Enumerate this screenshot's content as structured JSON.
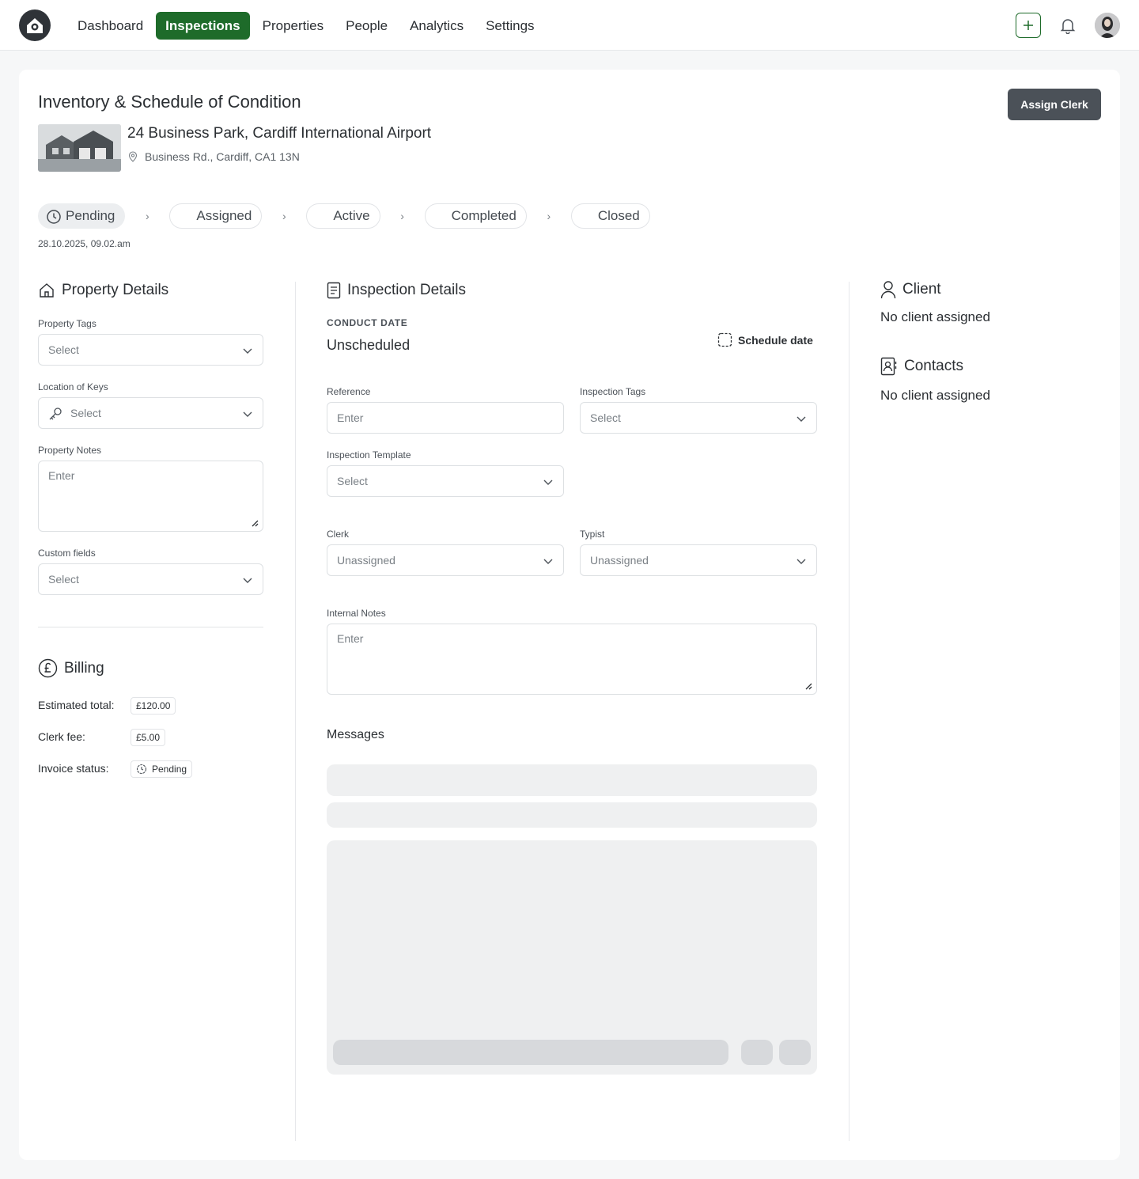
{
  "nav": {
    "items": [
      {
        "label": "Dashboard",
        "active": false
      },
      {
        "label": "Inspections",
        "active": true
      },
      {
        "label": "Properties",
        "active": false
      },
      {
        "label": "People",
        "active": false
      },
      {
        "label": "Analytics",
        "active": false
      },
      {
        "label": "Settings",
        "active": false
      }
    ],
    "accent": "#1e6b2a"
  },
  "header": {
    "title": "Inventory & Schedule of Condition",
    "assign_label": "Assign Clerk",
    "property_name": "24 Business Park, Cardiff International Airport",
    "property_address": "Business Rd., Cardiff, CA1 13N"
  },
  "pipeline": {
    "steps": [
      "Pending",
      "Assigned",
      "Active",
      "Completed",
      "Closed"
    ],
    "current": "Pending",
    "date": "28.10.2025, 09.02.am"
  },
  "property_details": {
    "title": "Property Details",
    "tags_label": "Property Tags",
    "tags_value": "Select",
    "keys_label": "Location of Keys",
    "keys_value": "Select",
    "notes_label": "Property Notes",
    "notes_placeholder": "Enter",
    "custom_label": "Custom fields",
    "custom_value": "Select"
  },
  "billing": {
    "title": "Billing",
    "estimated_label": "Estimated total:",
    "estimated_value": "£120.00",
    "clerk_fee_label": "Clerk fee:",
    "clerk_fee_value": "£5.00",
    "invoice_label": "Invoice status:",
    "invoice_value": "Pending"
  },
  "inspection": {
    "title": "Inspection Details",
    "conduct_label": "CONDUCT DATE",
    "conduct_value": "Unscheduled",
    "schedule_label": "Schedule date",
    "reference_label": "Reference",
    "reference_placeholder": "Enter",
    "tags_label": "Inspection Tags",
    "tags_value": "Select",
    "template_label": "Inspection Template",
    "template_value": "Select",
    "clerk_label": "Clerk",
    "clerk_value": "Unassigned",
    "typist_label": "Typist",
    "typist_value": "Unassigned",
    "notes_label": "Internal Notes",
    "notes_placeholder": "Enter",
    "messages_title": "Messages"
  },
  "client": {
    "title": "Client",
    "empty": "No client assigned"
  },
  "contacts": {
    "title": "Contacts",
    "empty": "No client assigned"
  }
}
